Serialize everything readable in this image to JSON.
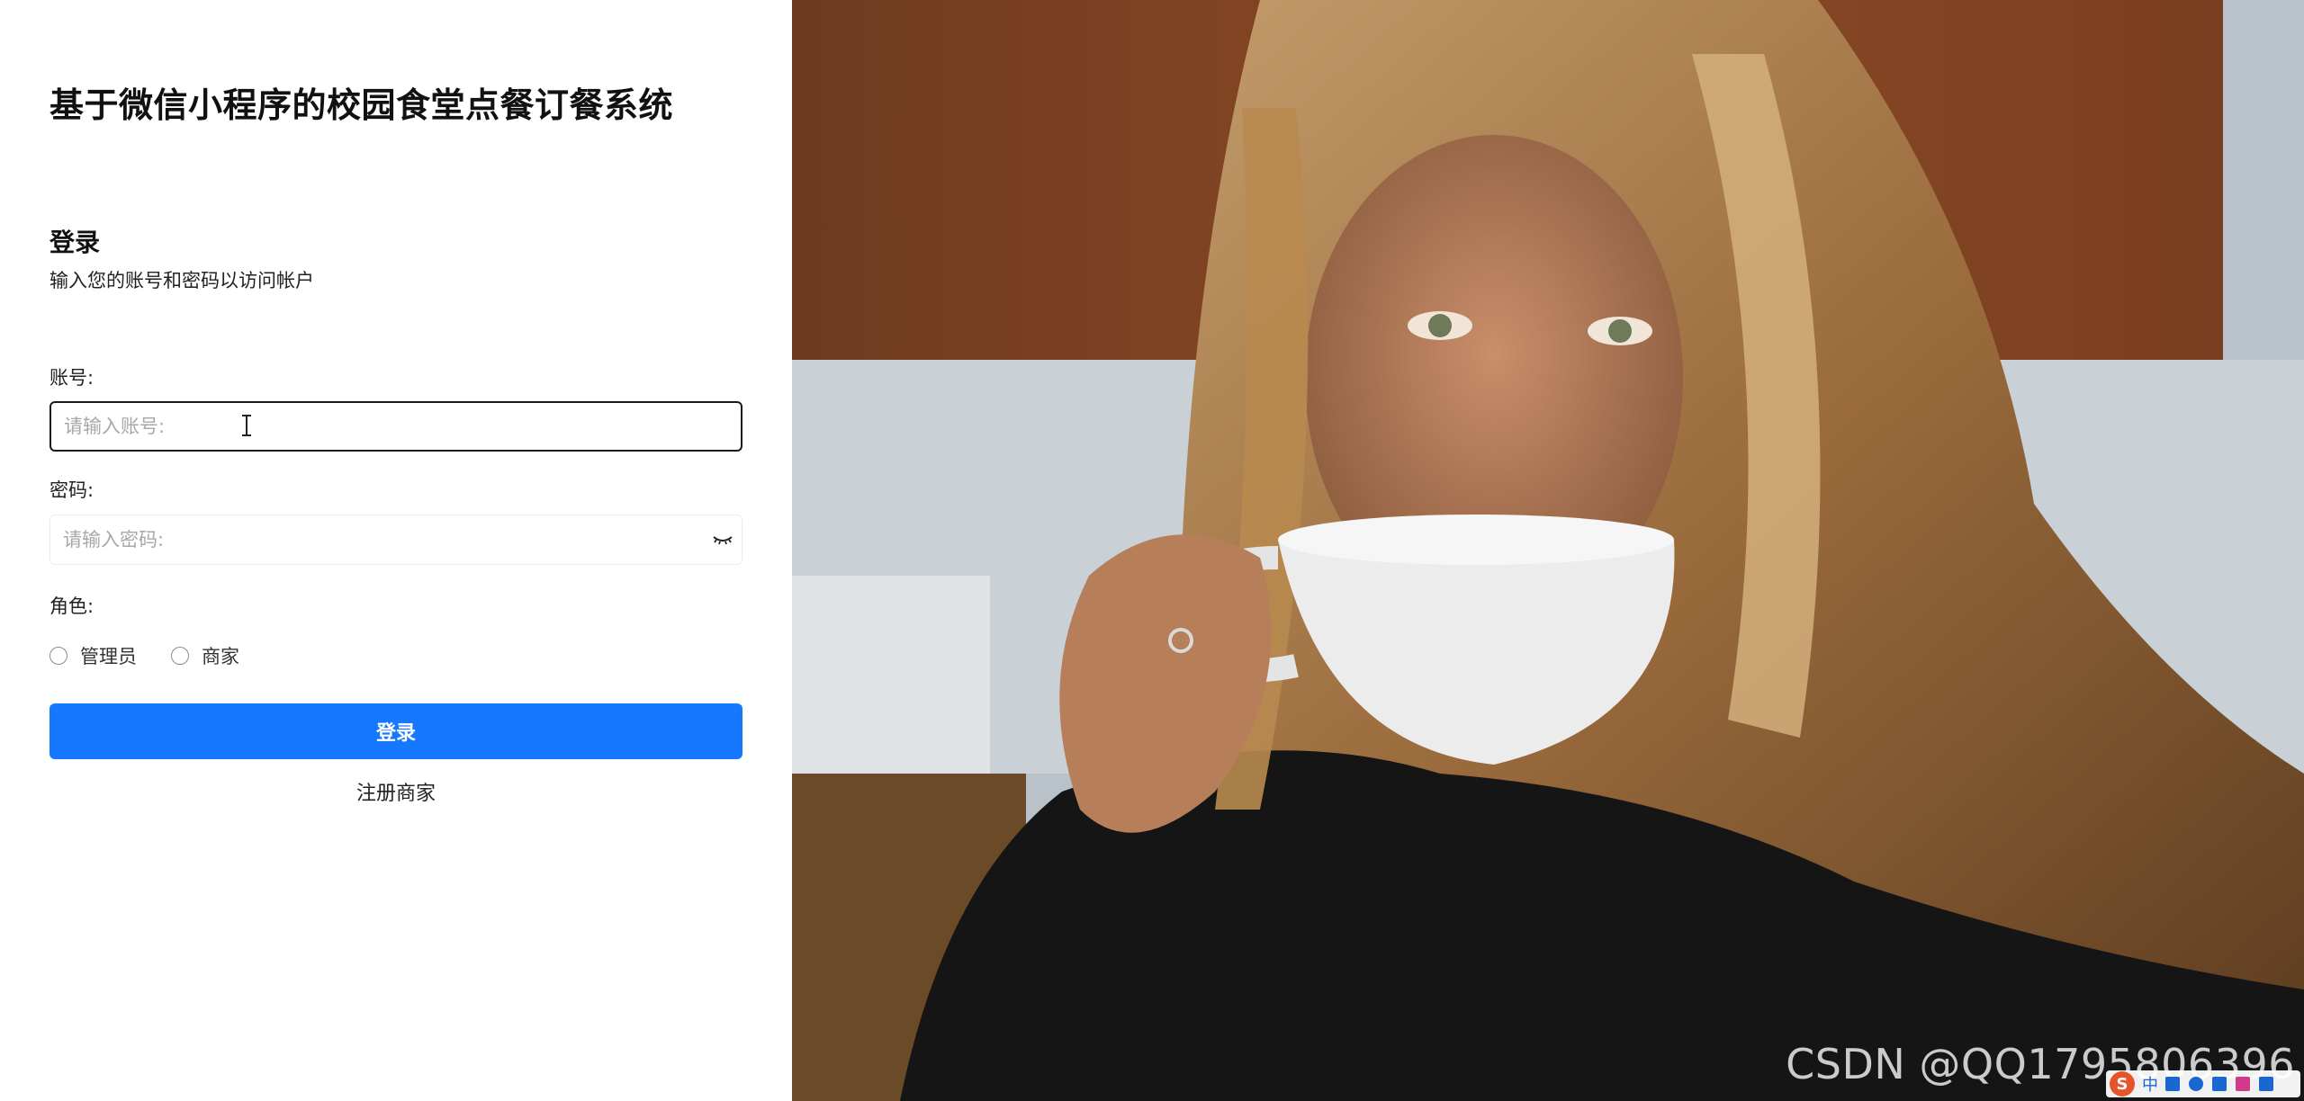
{
  "system_title": "基于微信小程序的校园食堂点餐订餐系统",
  "login": {
    "heading": "登录",
    "subtitle": "输入您的账号和密码以访问帐户"
  },
  "account": {
    "label": "账号:",
    "placeholder": "请输入账号:",
    "value": ""
  },
  "password": {
    "label": "密码:",
    "placeholder": "请输入密码:",
    "value": ""
  },
  "role": {
    "label": "角色:",
    "options": [
      "管理员",
      "商家"
    ],
    "selected": null
  },
  "submit_label": "登录",
  "register_label": "注册商家",
  "watermark": "CSDN @QQ1795806396",
  "ime": {
    "logo": "S",
    "mode": "中"
  },
  "colors": {
    "primary": "#1677ff",
    "text": "#1f1f1f"
  },
  "icons": [
    "eye-closed-icon",
    "text-cursor-icon",
    "sogou-ime-icon"
  ]
}
